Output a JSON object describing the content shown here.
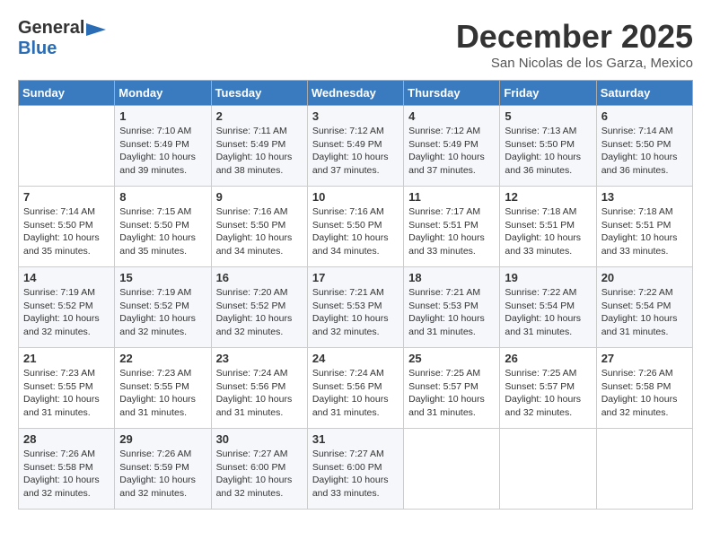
{
  "header": {
    "logo_general": "General",
    "logo_blue": "Blue",
    "month_title": "December 2025",
    "subtitle": "San Nicolas de los Garza, Mexico"
  },
  "days_of_week": [
    "Sunday",
    "Monday",
    "Tuesday",
    "Wednesday",
    "Thursday",
    "Friday",
    "Saturday"
  ],
  "weeks": [
    [
      {
        "day": "",
        "info": ""
      },
      {
        "day": "1",
        "info": "Sunrise: 7:10 AM\nSunset: 5:49 PM\nDaylight: 10 hours\nand 39 minutes."
      },
      {
        "day": "2",
        "info": "Sunrise: 7:11 AM\nSunset: 5:49 PM\nDaylight: 10 hours\nand 38 minutes."
      },
      {
        "day": "3",
        "info": "Sunrise: 7:12 AM\nSunset: 5:49 PM\nDaylight: 10 hours\nand 37 minutes."
      },
      {
        "day": "4",
        "info": "Sunrise: 7:12 AM\nSunset: 5:49 PM\nDaylight: 10 hours\nand 37 minutes."
      },
      {
        "day": "5",
        "info": "Sunrise: 7:13 AM\nSunset: 5:50 PM\nDaylight: 10 hours\nand 36 minutes."
      },
      {
        "day": "6",
        "info": "Sunrise: 7:14 AM\nSunset: 5:50 PM\nDaylight: 10 hours\nand 36 minutes."
      }
    ],
    [
      {
        "day": "7",
        "info": "Sunrise: 7:14 AM\nSunset: 5:50 PM\nDaylight: 10 hours\nand 35 minutes."
      },
      {
        "day": "8",
        "info": "Sunrise: 7:15 AM\nSunset: 5:50 PM\nDaylight: 10 hours\nand 35 minutes."
      },
      {
        "day": "9",
        "info": "Sunrise: 7:16 AM\nSunset: 5:50 PM\nDaylight: 10 hours\nand 34 minutes."
      },
      {
        "day": "10",
        "info": "Sunrise: 7:16 AM\nSunset: 5:50 PM\nDaylight: 10 hours\nand 34 minutes."
      },
      {
        "day": "11",
        "info": "Sunrise: 7:17 AM\nSunset: 5:51 PM\nDaylight: 10 hours\nand 33 minutes."
      },
      {
        "day": "12",
        "info": "Sunrise: 7:18 AM\nSunset: 5:51 PM\nDaylight: 10 hours\nand 33 minutes."
      },
      {
        "day": "13",
        "info": "Sunrise: 7:18 AM\nSunset: 5:51 PM\nDaylight: 10 hours\nand 33 minutes."
      }
    ],
    [
      {
        "day": "14",
        "info": "Sunrise: 7:19 AM\nSunset: 5:52 PM\nDaylight: 10 hours\nand 32 minutes."
      },
      {
        "day": "15",
        "info": "Sunrise: 7:19 AM\nSunset: 5:52 PM\nDaylight: 10 hours\nand 32 minutes."
      },
      {
        "day": "16",
        "info": "Sunrise: 7:20 AM\nSunset: 5:52 PM\nDaylight: 10 hours\nand 32 minutes."
      },
      {
        "day": "17",
        "info": "Sunrise: 7:21 AM\nSunset: 5:53 PM\nDaylight: 10 hours\nand 32 minutes."
      },
      {
        "day": "18",
        "info": "Sunrise: 7:21 AM\nSunset: 5:53 PM\nDaylight: 10 hours\nand 31 minutes."
      },
      {
        "day": "19",
        "info": "Sunrise: 7:22 AM\nSunset: 5:54 PM\nDaylight: 10 hours\nand 31 minutes."
      },
      {
        "day": "20",
        "info": "Sunrise: 7:22 AM\nSunset: 5:54 PM\nDaylight: 10 hours\nand 31 minutes."
      }
    ],
    [
      {
        "day": "21",
        "info": "Sunrise: 7:23 AM\nSunset: 5:55 PM\nDaylight: 10 hours\nand 31 minutes."
      },
      {
        "day": "22",
        "info": "Sunrise: 7:23 AM\nSunset: 5:55 PM\nDaylight: 10 hours\nand 31 minutes."
      },
      {
        "day": "23",
        "info": "Sunrise: 7:24 AM\nSunset: 5:56 PM\nDaylight: 10 hours\nand 31 minutes."
      },
      {
        "day": "24",
        "info": "Sunrise: 7:24 AM\nSunset: 5:56 PM\nDaylight: 10 hours\nand 31 minutes."
      },
      {
        "day": "25",
        "info": "Sunrise: 7:25 AM\nSunset: 5:57 PM\nDaylight: 10 hours\nand 31 minutes."
      },
      {
        "day": "26",
        "info": "Sunrise: 7:25 AM\nSunset: 5:57 PM\nDaylight: 10 hours\nand 32 minutes."
      },
      {
        "day": "27",
        "info": "Sunrise: 7:26 AM\nSunset: 5:58 PM\nDaylight: 10 hours\nand 32 minutes."
      }
    ],
    [
      {
        "day": "28",
        "info": "Sunrise: 7:26 AM\nSunset: 5:58 PM\nDaylight: 10 hours\nand 32 minutes."
      },
      {
        "day": "29",
        "info": "Sunrise: 7:26 AM\nSunset: 5:59 PM\nDaylight: 10 hours\nand 32 minutes."
      },
      {
        "day": "30",
        "info": "Sunrise: 7:27 AM\nSunset: 6:00 PM\nDaylight: 10 hours\nand 32 minutes."
      },
      {
        "day": "31",
        "info": "Sunrise: 7:27 AM\nSunset: 6:00 PM\nDaylight: 10 hours\nand 33 minutes."
      },
      {
        "day": "",
        "info": ""
      },
      {
        "day": "",
        "info": ""
      },
      {
        "day": "",
        "info": ""
      }
    ]
  ]
}
